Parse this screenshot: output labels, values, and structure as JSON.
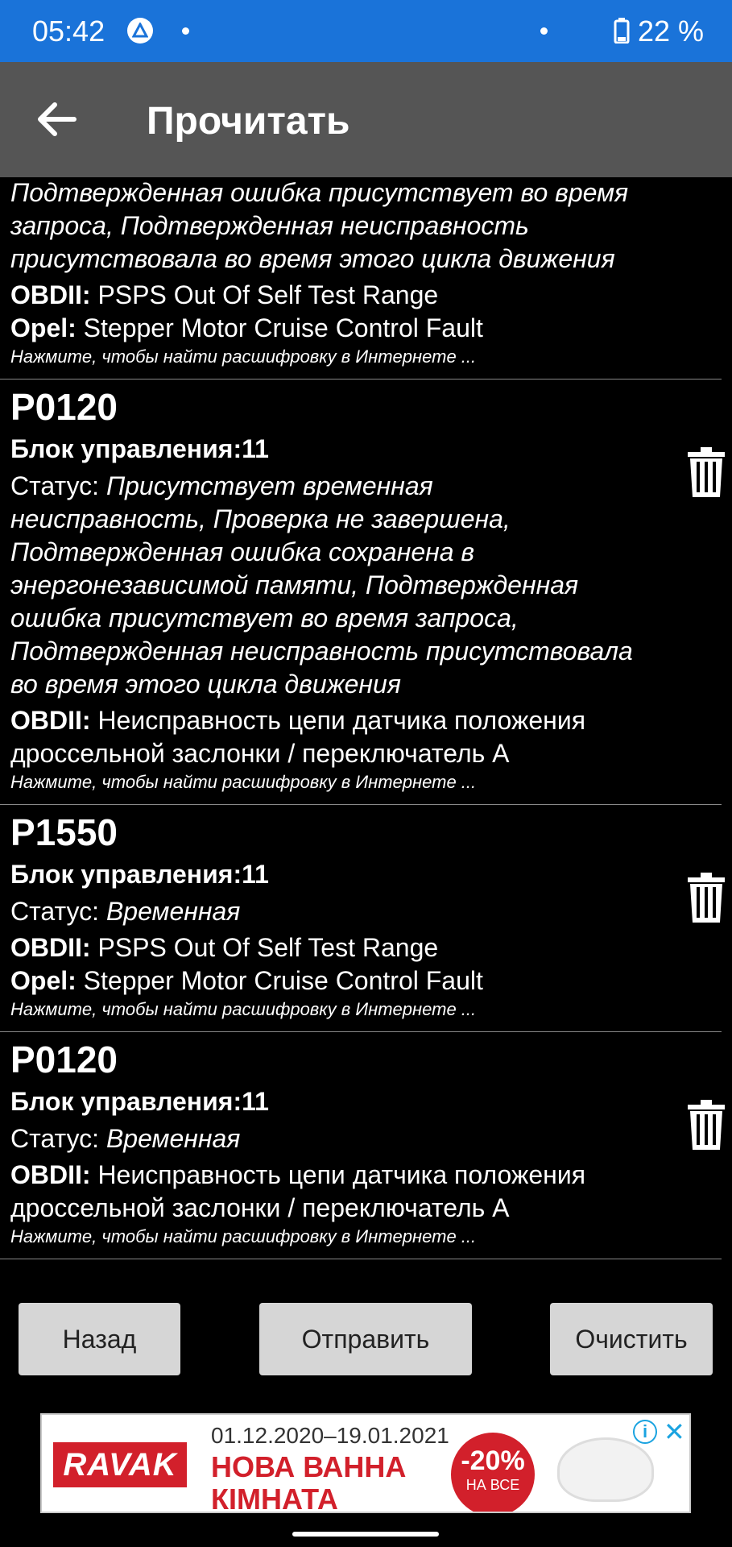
{
  "status_bar": {
    "time": "05:42",
    "battery": "22 %"
  },
  "app_bar": {
    "title": "Прочитать"
  },
  "partial_item": {
    "status_tail": "Подтвержденная ошибка присутствует во время запроса, Подтвержденная неисправность присутствовала во время этого цикла движения",
    "obd_label": "OBDII:",
    "obd_value": "PSPS Out Of Self Test Range",
    "make_label": "Opel:",
    "make_value": "Stepper Motor Cruise Control Fault",
    "hint": "Нажмите, чтобы найти расшифровку в Интернете ..."
  },
  "items": [
    {
      "code": "P0120",
      "block": "Блок управления:11",
      "status_label": "Статус:",
      "status_value": "Присутствует временная неисправность, Проверка не завершена, Подтвержденная ошибка сохранена в энергонезависимой памяти, Подтвержденная ошибка присутствует во время запроса, Подтвержденная неисправность присутствовала во время этого цикла движения",
      "obd_label": "OBDII:",
      "obd_value": "Неисправность цепи датчика положения дроссельной заслонки / переключатель A",
      "hint": "Нажмите, чтобы найти расшифровку в Интернете ..."
    },
    {
      "code": "P1550",
      "block": "Блок управления:11",
      "status_label": "Статус:",
      "status_value": "Временная",
      "obd_label": "OBDII:",
      "obd_value": "PSPS Out Of Self Test Range",
      "make_label": "Opel:",
      "make_value": "Stepper Motor Cruise Control Fault",
      "hint": "Нажмите, чтобы найти расшифровку в Интернете ..."
    },
    {
      "code": "P0120",
      "block": "Блок управления:11",
      "status_label": "Статус:",
      "status_value": "Временная",
      "obd_label": "OBDII:",
      "obd_value": "Неисправность цепи датчика положения дроссельной заслонки / переключатель A",
      "hint": "Нажмите, чтобы найти расшифровку в Интернете ..."
    }
  ],
  "buttons": {
    "back": "Назад",
    "send": "Отправить",
    "clear": "Очистить"
  },
  "ad": {
    "brand": "RAVAK",
    "dates": "01.12.2020–19.01.2021",
    "line1": "НОВА ВАННА",
    "line2": "КІМНАТА",
    "discount": "-20%",
    "discount_sub": "НА ВСЕ",
    "accent_color": "#d2202b"
  },
  "colors": {
    "status_bar": "#1a73d9",
    "app_bar": "#555555",
    "background": "#000000",
    "button": "#d6d6d6"
  }
}
